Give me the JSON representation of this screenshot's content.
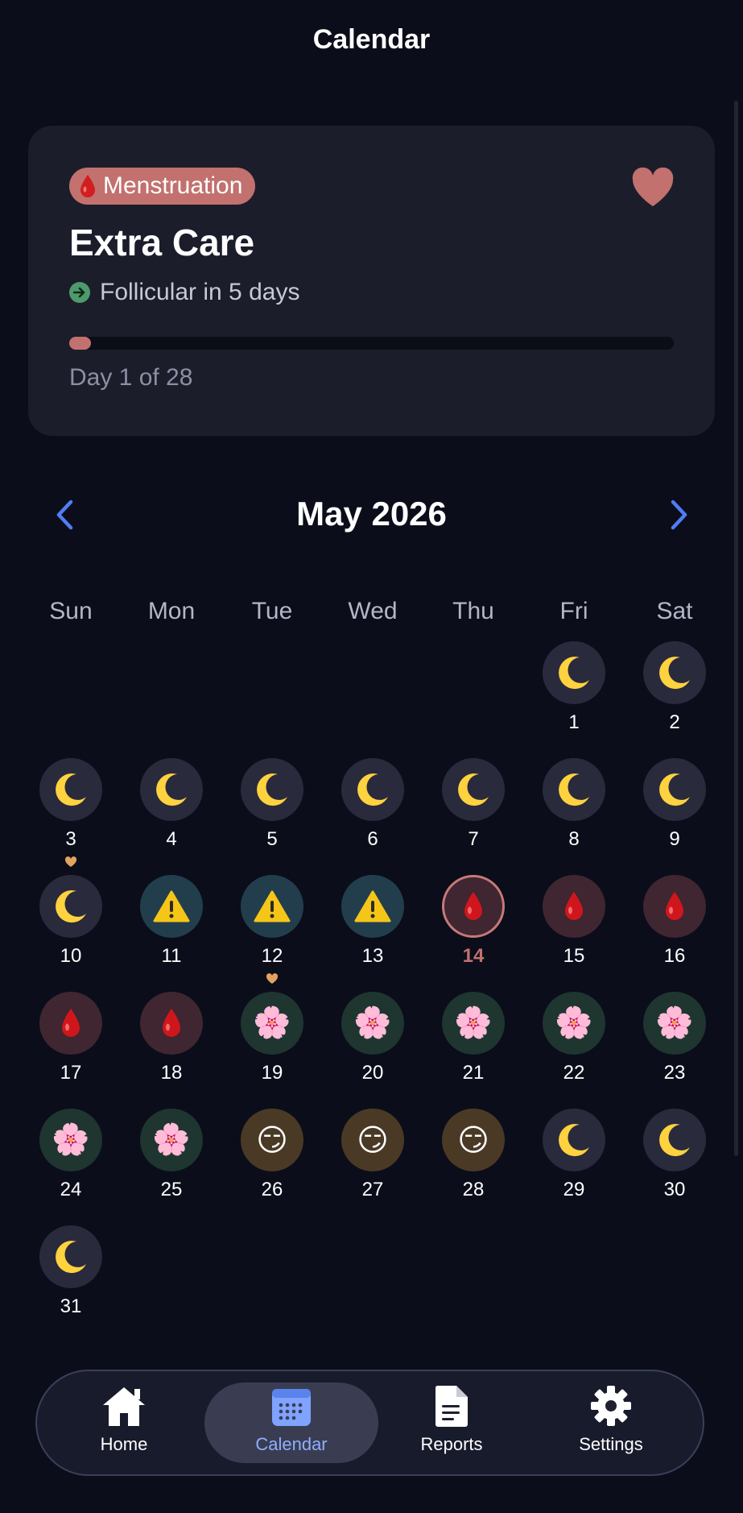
{
  "screen_title": "Calendar",
  "phase_card": {
    "badge_label": "Menstruation",
    "title": "Extra Care",
    "next_phase_text": "Follicular in 5 days",
    "progress_fraction": 0.036,
    "day_text": "Day 1 of 28",
    "favorite_icon": "heart-icon",
    "colors": {
      "accent": "#c2716e",
      "next_dot": "#4f9a6c"
    }
  },
  "calendar": {
    "month_title": "May 2026",
    "prev_icon": "chevron-left-icon",
    "next_icon": "chevron-right-icon",
    "weekdays": [
      "Sun",
      "Mon",
      "Tue",
      "Wed",
      "Thu",
      "Fri",
      "Sat"
    ],
    "first_weekday_index": 5,
    "today": 14,
    "days": [
      {
        "d": "1",
        "t": "sleep"
      },
      {
        "d": "2",
        "t": "sleep"
      },
      {
        "d": "3",
        "t": "sleep",
        "mark": true
      },
      {
        "d": "4",
        "t": "sleep"
      },
      {
        "d": "5",
        "t": "sleep"
      },
      {
        "d": "6",
        "t": "sleep"
      },
      {
        "d": "7",
        "t": "sleep"
      },
      {
        "d": "8",
        "t": "sleep"
      },
      {
        "d": "9",
        "t": "sleep"
      },
      {
        "d": "10",
        "t": "sleep"
      },
      {
        "d": "11",
        "t": "warn"
      },
      {
        "d": "12",
        "t": "warn",
        "mark": true
      },
      {
        "d": "13",
        "t": "warn"
      },
      {
        "d": "14",
        "t": "period"
      },
      {
        "d": "15",
        "t": "period"
      },
      {
        "d": "16",
        "t": "period"
      },
      {
        "d": "17",
        "t": "period"
      },
      {
        "d": "18",
        "t": "period"
      },
      {
        "d": "19",
        "t": "fol"
      },
      {
        "d": "20",
        "t": "fol"
      },
      {
        "d": "21",
        "t": "fol"
      },
      {
        "d": "22",
        "t": "fol"
      },
      {
        "d": "23",
        "t": "fol"
      },
      {
        "d": "24",
        "t": "fol"
      },
      {
        "d": "25",
        "t": "fol"
      },
      {
        "d": "26",
        "t": "ovu"
      },
      {
        "d": "27",
        "t": "ovu"
      },
      {
        "d": "28",
        "t": "ovu"
      },
      {
        "d": "29",
        "t": "sleep"
      },
      {
        "d": "30",
        "t": "sleep"
      },
      {
        "d": "31",
        "t": "sleep"
      }
    ],
    "day_types": {
      "sleep": {
        "icon": "crescent-moon-icon",
        "glyph": "🌙",
        "bg": "#2a2a3d"
      },
      "warn": {
        "icon": "warning-icon",
        "glyph": "⚠",
        "bg": "#223e4c"
      },
      "period": {
        "icon": "blood-drop-icon",
        "glyph": "",
        "bg": "#3f2630"
      },
      "fol": {
        "icon": "cherry-blossom-icon",
        "glyph": "🌸",
        "bg": "#1e3530"
      },
      "ovu": {
        "icon": "smirk-face-icon",
        "glyph": "😏",
        "bg": "#4a3a25"
      }
    }
  },
  "tabbar": {
    "tabs": [
      {
        "label": "Home",
        "icon": "home-icon",
        "active": false
      },
      {
        "label": "Calendar",
        "icon": "calendar-icon",
        "active": true
      },
      {
        "label": "Reports",
        "icon": "document-icon",
        "active": false
      },
      {
        "label": "Settings",
        "icon": "gear-icon",
        "active": false
      }
    ]
  }
}
